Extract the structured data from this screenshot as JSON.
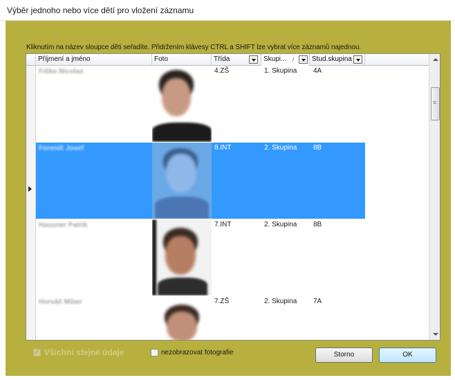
{
  "window": {
    "title": "Výběr jednoho nebo více dětí pro vložení záznamu"
  },
  "hint": "Kliknutím na název sloupce děti seřadíte. Přidržením klávesy CTRL a SHIFT lze vybrat více záznamů najednou.",
  "columns": {
    "name": "Příjmení a jméno",
    "photo": "Foto",
    "class": "Třída",
    "group": "Skupi...",
    "group_sort": "/",
    "study_group": "Stud.skupina"
  },
  "rows": [
    {
      "name": "Fiško Nicolas",
      "class": "4.ZŠ",
      "group": "1. Skupina",
      "study_group": "4A",
      "selected": false
    },
    {
      "name": "Forenič Josef",
      "class": "8.INT",
      "group": "2. Skupina",
      "study_group": "8B",
      "selected": true
    },
    {
      "name": "Hausner Patrik",
      "class": "7.INT",
      "group": "2. Skupina",
      "study_group": "8B",
      "selected": false
    },
    {
      "name": "Horváč Milan",
      "class": "7.ZŠ",
      "group": "2. Skupina",
      "study_group": "7A",
      "selected": false
    }
  ],
  "footer": {
    "same_data_label": "Všichni stejné údaje",
    "same_data_checked": true,
    "hide_photos_label": "nezobrazovat fotografie",
    "hide_photos_checked": false,
    "cancel_label": "Storno",
    "ok_label": "OK"
  },
  "colors": {
    "frame": "#b7b03f",
    "selection": "#3399ff"
  }
}
